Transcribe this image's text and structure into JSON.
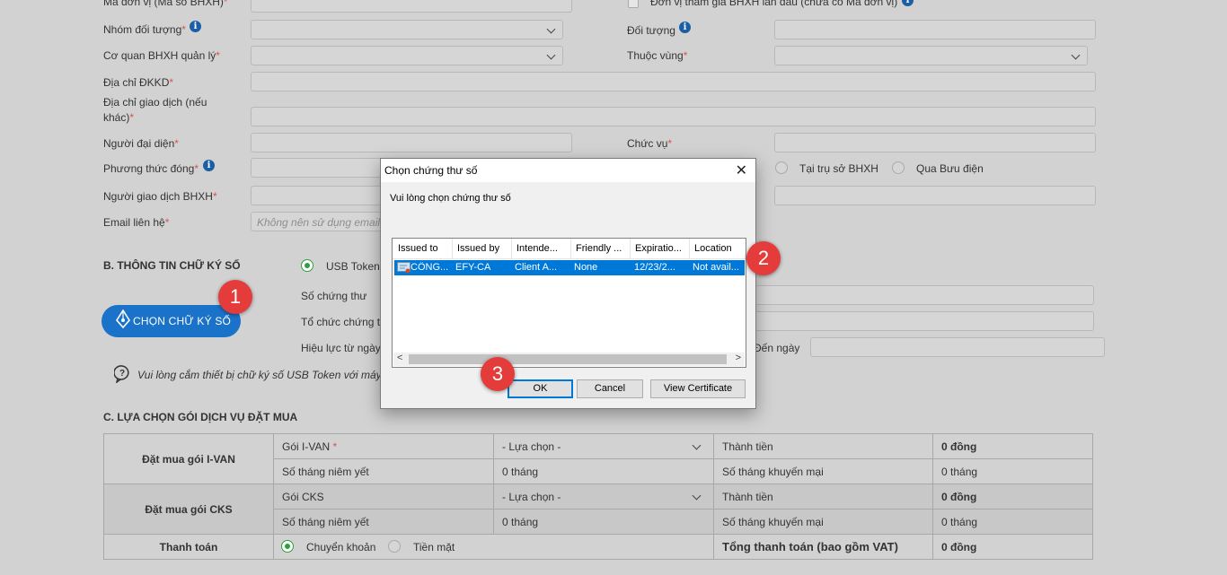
{
  "form": {
    "ma_don_vi_label": "Mã đơn vị (Mã số BHXH)",
    "first_time_label": "Đơn vị tham gia BHXH lần đầu (chưa có Mã đơn vị)",
    "nhom_doi_tuong_label": "Nhóm đối tượng",
    "doi_tuong_label": "Đối tượng",
    "co_quan_label": "Cơ quan BHXH quản lý",
    "thuoc_vung_label": "Thuộc vùng",
    "dia_chi_dkkd_label": "Địa chỉ ĐKKD",
    "dia_chi_gd_label_1": "Địa chỉ giao dịch (nếu",
    "dia_chi_gd_label_2": "khác)",
    "nguoi_dai_dien_label": "Người đại diện",
    "chuc_vu_label": "Chức vụ",
    "phuong_thuc_label": "Phương thức đóng",
    "tai_tru_so_label": "Tại trụ sở BHXH",
    "qua_buu_dien_label": "Qua Bưu điện",
    "nguoi_gd_label": "Người giao dịch BHXH",
    "email_label": "Email liên hệ",
    "email_placeholder": "Không nên sử dụng email",
    "required_mark": "*"
  },
  "signature": {
    "section_title": "B. THÔNG TIN CHỮ KÝ SỐ",
    "usb_token_label": "USB Token",
    "button_label": "CHỌN CHỮ KÝ SỐ",
    "so_chung_thu_label": "Số chứng thư",
    "to_chuc_label": "Tổ chức chứng t",
    "hieu_luc_label": "Hiệu lực từ ngày",
    "den_ngay_label": "Đến ngày",
    "hint_text": "Vui lòng cắm thiết bị chữ ký số USB Token với máy"
  },
  "badges": [
    "1",
    "2",
    "3"
  ],
  "dialog": {
    "title": "Chọn chứng thư số",
    "close_glyph": "✕",
    "message": "Vui lòng chọn chứng thư số",
    "columns": [
      "Issued to",
      "Issued by",
      "Intende...",
      "Friendly ...",
      "Expiratio...",
      "Location"
    ],
    "rows": [
      {
        "issued_to": "CÔNG...",
        "issued_by": "EFY-CA",
        "intended": "Client A...",
        "friendly": "None",
        "expiration": "12/23/2...",
        "location": "Not avail..."
      }
    ],
    "scroll_left": "<",
    "scroll_right": ">",
    "ok_label": "OK",
    "cancel_label": "Cancel",
    "view_cert_label": "View Certificate"
  },
  "services": {
    "section_title": "C. LỰA CHỌN GÓI DỊCH VỤ ĐẶT MUA",
    "ivan_group": "Đặt mua gói I-VAN",
    "ivan_package_label": "Gói I-VAN",
    "ivan_select": "- Lựa chọn -",
    "cks_group": "Đặt mua gói CKS",
    "cks_package_label": "Gói CKS",
    "cks_select": "- Lựa chọn -",
    "thanh_tien_label": "Thành tiền",
    "so_thang_niem_yet_label": "Số tháng niêm yết",
    "so_thang_khuyen_mai_label": "Số tháng khuyến mại",
    "ivan_thanh_tien": "0 đồng",
    "ivan_niem_yet": "0 tháng",
    "ivan_khuyen_mai": "0 tháng",
    "cks_thanh_tien": "0 đồng",
    "cks_niem_yet": "0 tháng",
    "cks_khuyen_mai": "0 tháng",
    "thanh_toan_label": "Thanh toán",
    "chuyen_khoan_label": "Chuyển khoản",
    "tien_mat_label": "Tiền mặt",
    "tong_label": "Tổng thanh toán (bao gồm VAT)",
    "tong_value": "0 đồng"
  }
}
